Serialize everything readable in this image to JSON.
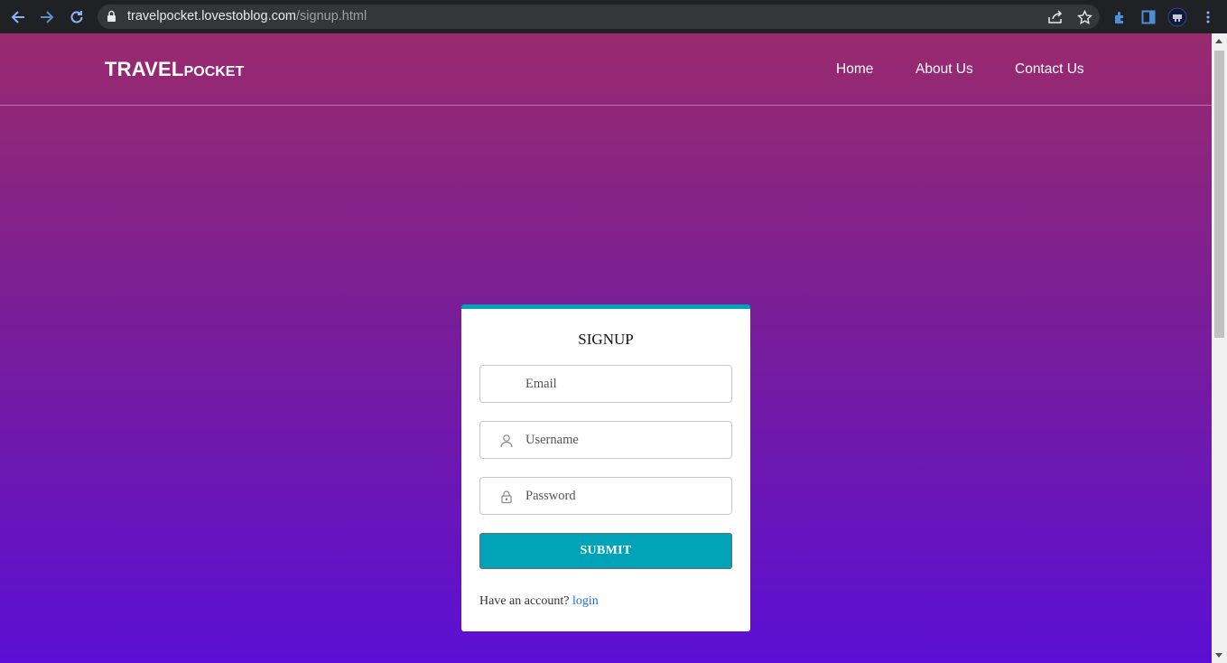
{
  "browser": {
    "url_host": "travelpocket.lovestoblog.com",
    "url_path": "/signup.html"
  },
  "site": {
    "logo_big": "TRAVEL",
    "logo_small": "POCKET",
    "nav": [
      {
        "label": "Home"
      },
      {
        "label": "About Us"
      },
      {
        "label": "Contact Us"
      }
    ]
  },
  "form": {
    "title": "SIGNUP",
    "email_placeholder": "Email",
    "username_placeholder": "Username",
    "password_placeholder": "Password",
    "submit_label": "SUBMIT",
    "account_prompt": "Have an account?",
    "login_link": "login"
  },
  "colors": {
    "accent": "#00a3b8",
    "gradient_top": "#992a6e",
    "gradient_bottom": "#5b0fd4",
    "link": "#1a6fe0"
  }
}
